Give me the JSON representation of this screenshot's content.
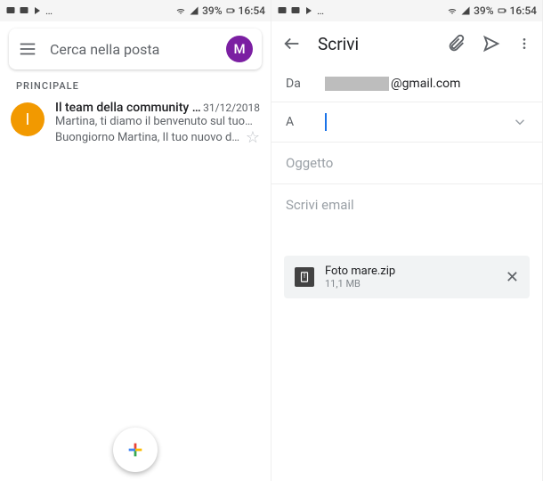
{
  "statusbar": {
    "battery": "39%",
    "time": "16:54"
  },
  "left": {
    "search_placeholder": "Cerca nella posta",
    "avatar_initial": "M",
    "section_label": "PRINCIPALE",
    "email": {
      "avatar_initial": "I",
      "sender": "Il team della community G…",
      "date": "31/12/2018",
      "subject": "Martina, ti diamo il benvenuto sul tuo…",
      "snippet": "Buongiorno Martina, Il tuo nuovo dispo…"
    }
  },
  "right": {
    "title": "Scrivi",
    "from_label": "Da",
    "from_domain": "@gmail.com",
    "to_label": "A",
    "subject_placeholder": "Oggetto",
    "body_placeholder": "Scrivi email",
    "attachment": {
      "name": "Foto mare.zip",
      "size": "11,1 MB"
    }
  }
}
